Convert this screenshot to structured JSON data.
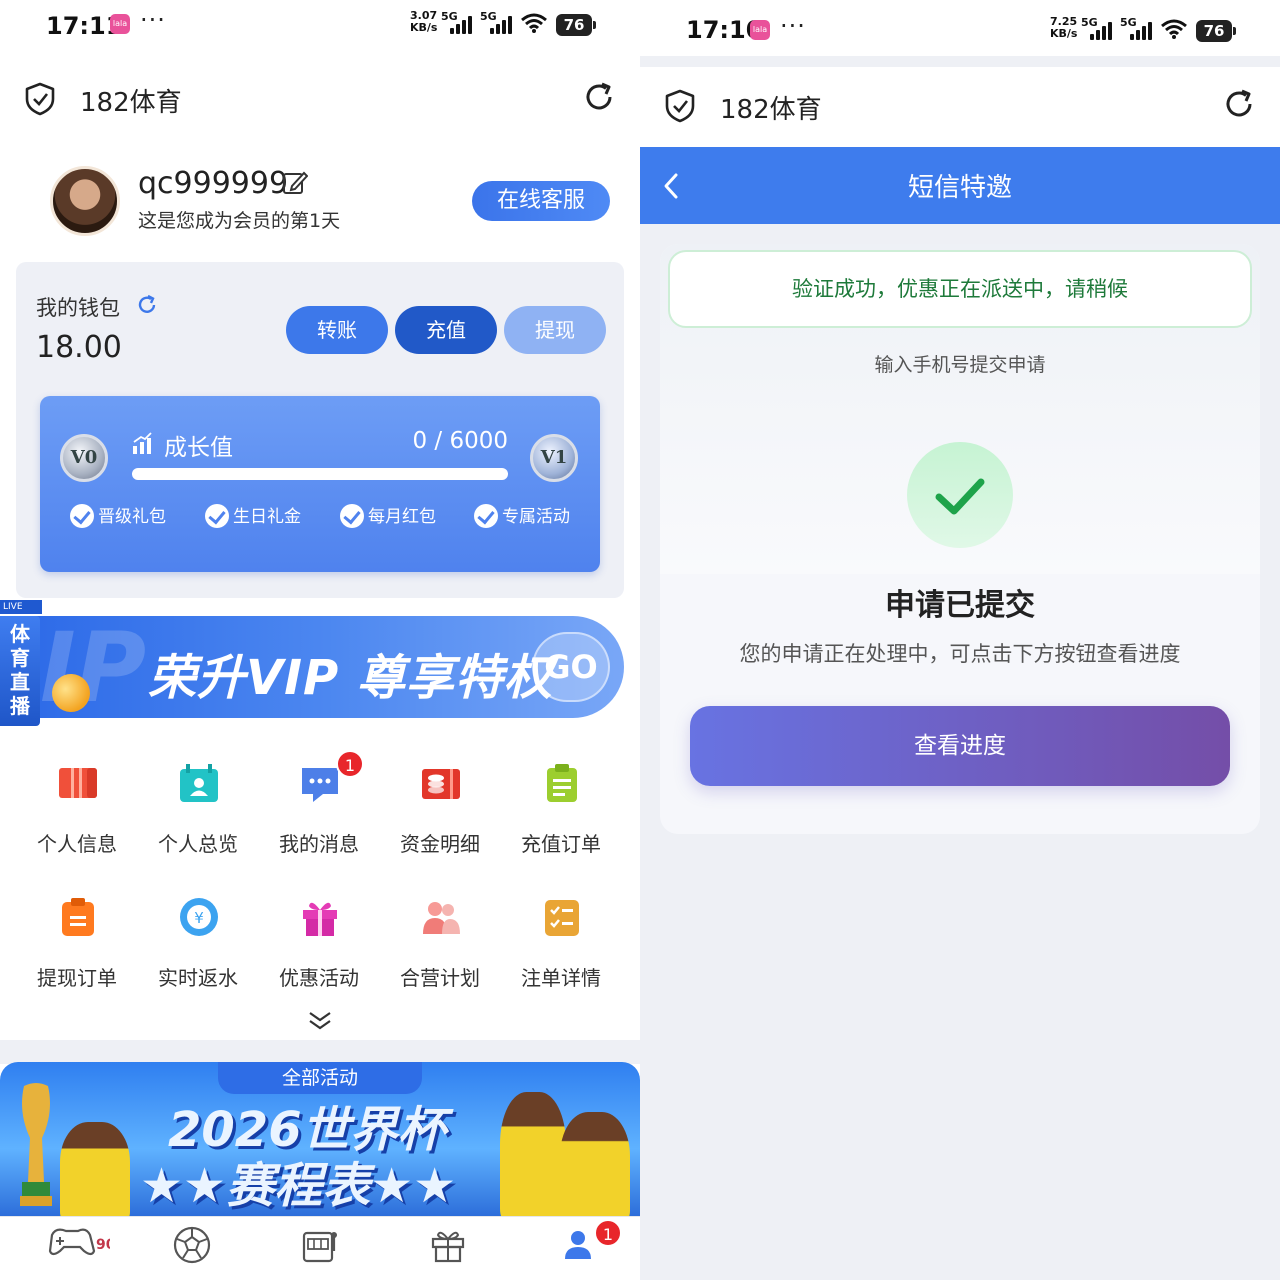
{
  "left": {
    "status": {
      "time": "17:11",
      "app_badge": "lala",
      "dots": "···",
      "speed_top": "3.07",
      "speed_bottom": "KB/s",
      "net1": "5G",
      "net2": "5G",
      "battery": "76"
    },
    "appbar": {
      "title": "182体育"
    },
    "profile": {
      "username": "qc999999",
      "member_days": "这是您成为会员的第1天",
      "cs_button": "在线客服"
    },
    "wallet": {
      "title": "我的钱包",
      "balance": "18.00",
      "buttons": {
        "transfer": "转账",
        "recharge": "充值",
        "withdraw": "提现"
      },
      "growth": {
        "label": "成长值",
        "value": "0 / 6000",
        "progress": 0,
        "badge_left": "V0",
        "badge_right": "V1",
        "perks": [
          "晋级礼包",
          "生日礼金",
          "每月红包",
          "专属活动"
        ]
      }
    },
    "live_tag": {
      "top": "LIVE",
      "body": "体育直播"
    },
    "vip_banner": {
      "text": "荣升VIP 尊享特权",
      "go": "GO"
    },
    "grid": [
      {
        "label": "个人信息",
        "icon": "id-card-icon"
      },
      {
        "label": "个人总览",
        "icon": "calendar-user-icon"
      },
      {
        "label": "我的消息",
        "icon": "message-icon",
        "badge": "1"
      },
      {
        "label": "资金明细",
        "icon": "funds-icon"
      },
      {
        "label": "充值订单",
        "icon": "clipboard-icon"
      },
      {
        "label": "提现订单",
        "icon": "withdraw-order-icon"
      },
      {
        "label": "实时返水",
        "icon": "rebate-icon"
      },
      {
        "label": "优惠活动",
        "icon": "gift-icon"
      },
      {
        "label": "合营计划",
        "icon": "partners-icon"
      },
      {
        "label": "注单详情",
        "icon": "bet-list-icon"
      }
    ],
    "activity_banner": {
      "tab": "全部活动",
      "line1": "2026世界杯",
      "line2": "★★赛程表★★"
    },
    "bottom_nav": {
      "profile_badge": "1"
    },
    "colors": {
      "primary": "#3d78ea",
      "dark_primary": "#2159c8",
      "light_primary": "#8fb2f3",
      "badge_red": "#e8262b"
    }
  },
  "right": {
    "status": {
      "time": "17:10",
      "app_badge": "lala",
      "dots": "···",
      "speed_top": "7.25",
      "speed_bottom": "KB/s",
      "net1": "5G",
      "net2": "5G",
      "battery": "76"
    },
    "appbar": {
      "title": "182体育"
    },
    "header": {
      "title": "短信特邀"
    },
    "success_banner": "验证成功，优惠正在派送中，请稍候",
    "subtitle": "输入手机号提交申请",
    "heading": "申请已提交",
    "description": "您的申请正在处理中，可点击下方按钮查看进度",
    "button": "查看进度",
    "colors": {
      "header": "#3e7ced",
      "success_text": "#1e7a3a",
      "button_from": "#6873e2",
      "button_to": "#744ea8"
    }
  }
}
